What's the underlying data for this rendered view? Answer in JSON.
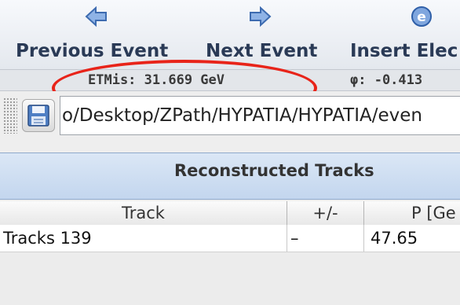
{
  "toolbar": {
    "previous_label": "Previous Event",
    "next_label": "Next Event",
    "insert_label": "Insert Elec"
  },
  "status": {
    "etmis": "ETMis: 31.669 GeV",
    "phi": "φ: -0.413"
  },
  "path": {
    "value": "o/Desktop/ZPath/HYPATIA/HYPATIA/even"
  },
  "panel": {
    "title": "Reconstructed Tracks",
    "columns": [
      "Track",
      "+/-",
      "P [Ge"
    ],
    "rows": [
      {
        "track": "Tracks 139",
        "sign": "–",
        "p": "47.65"
      }
    ]
  },
  "colors": {
    "accent_blue": "#6e9bd6",
    "highlight_red": "#e8241a",
    "header_blue": "#c3d6ee"
  },
  "icons": {
    "previous": "arrow-left-icon",
    "next": "arrow-right-icon",
    "insert": "electron-e-icon",
    "save": "floppy-disk-icon"
  }
}
